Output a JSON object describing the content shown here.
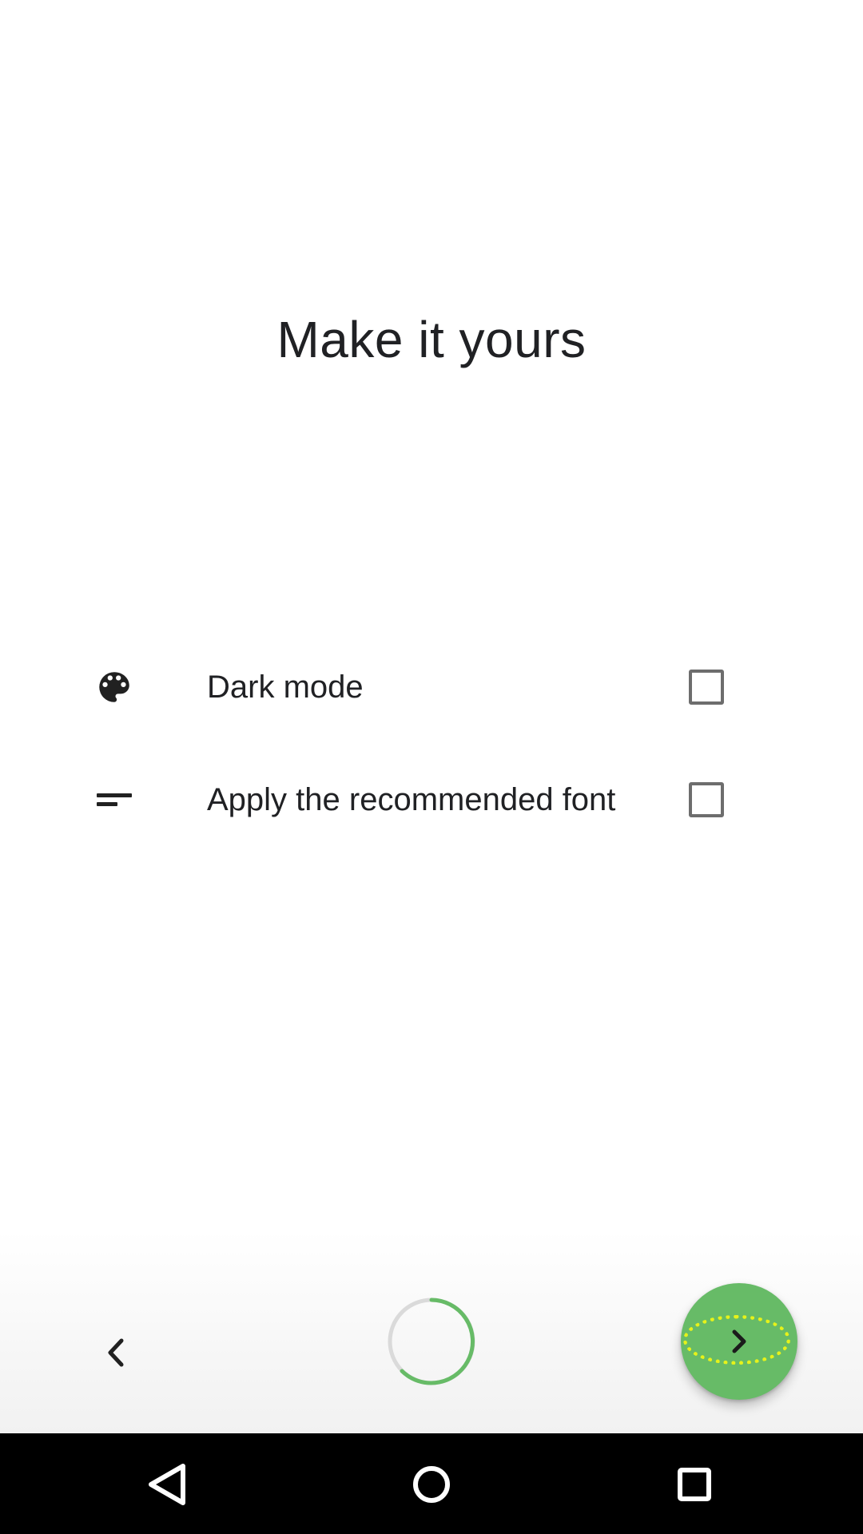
{
  "page": {
    "title": "Make it yours"
  },
  "options": [
    {
      "icon": "palette-icon",
      "label": "Dark mode",
      "checked": false
    },
    {
      "icon": "short-text-icon",
      "label": "Apply the recommended font",
      "checked": false
    }
  ],
  "navigation": {
    "back_icon": "chevron-left-icon",
    "progress_icon": "progress-ring-icon",
    "next_icon": "chevron-right-icon",
    "accent_color": "#67bb67",
    "highlight_color": "#e6f21a"
  },
  "system_nav": {
    "back_icon": "triangle-back-icon",
    "home_icon": "circle-home-icon",
    "recents_icon": "square-recents-icon"
  }
}
